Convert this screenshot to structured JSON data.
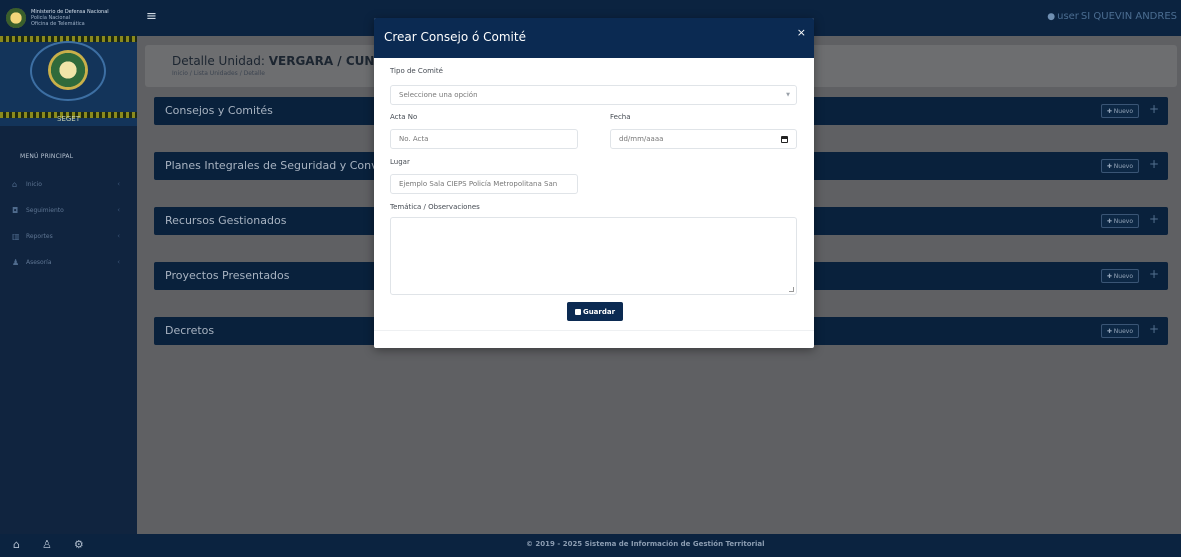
{
  "header": {
    "brand_lines": [
      "Ministerio de Defensa Nacional",
      "Policía Nacional",
      "Oficina de Telemática"
    ],
    "menu_icon": "hamburger-icon",
    "user_icon": "user-icon",
    "user_label": "user",
    "user_name": "SI QUEVIN ANDRES"
  },
  "sidebar": {
    "banner_label": "SEGET",
    "menu_title": "MENÚ PRINCIPAL",
    "items": [
      {
        "label": "Inicio",
        "icon": "home-icon"
      },
      {
        "label": "Seguimiento",
        "icon": "camera-icon"
      },
      {
        "label": "Reportes",
        "icon": "chart-icon"
      },
      {
        "label": "Asesoría",
        "icon": "people-icon"
      }
    ]
  },
  "page": {
    "title_prefix": "Detalle Unidad:",
    "title_strong": "VERGARA / CUNDINAMARCA",
    "breadcrumb": [
      "Inicio",
      "Lista Unidades",
      "Detalle"
    ]
  },
  "sections": [
    {
      "title": "Consejos y Comités",
      "button": "Nuevo"
    },
    {
      "title": "Planes Integrales de Seguridad y Convivencia Ciudadana",
      "button": "Nuevo"
    },
    {
      "title": "Recursos Gestionados",
      "button": "Nuevo"
    },
    {
      "title": "Proyectos Presentados",
      "button": "Nuevo"
    },
    {
      "title": "Decretos",
      "button": "Nuevo"
    }
  ],
  "modal": {
    "title": "Crear Consejo ó Comité",
    "close": "×",
    "tipo_label": "Tipo de Comité",
    "tipo_value": "Seleccione una opción",
    "acta_label": "Acta No",
    "acta_placeholder": "No. Acta",
    "fecha_label": "Fecha",
    "fecha_placeholder": "dd/mm/aaaa",
    "lugar_label": "Lugar",
    "lugar_placeholder": "Ejemplo Sala CIEPS Policía Metropolitana San",
    "tematica_label": "Temática / Observaciones",
    "save_label": "Guardar"
  },
  "footer": {
    "icons": [
      "home-icon",
      "user-icon",
      "settings-icon"
    ],
    "copyright": "© 2019 - 2025 Sistema de Información de Gestión Territorial"
  },
  "colors": {
    "navy": "#0b2a52",
    "overlay": "#5f6063",
    "accent": "#4b6d91"
  }
}
